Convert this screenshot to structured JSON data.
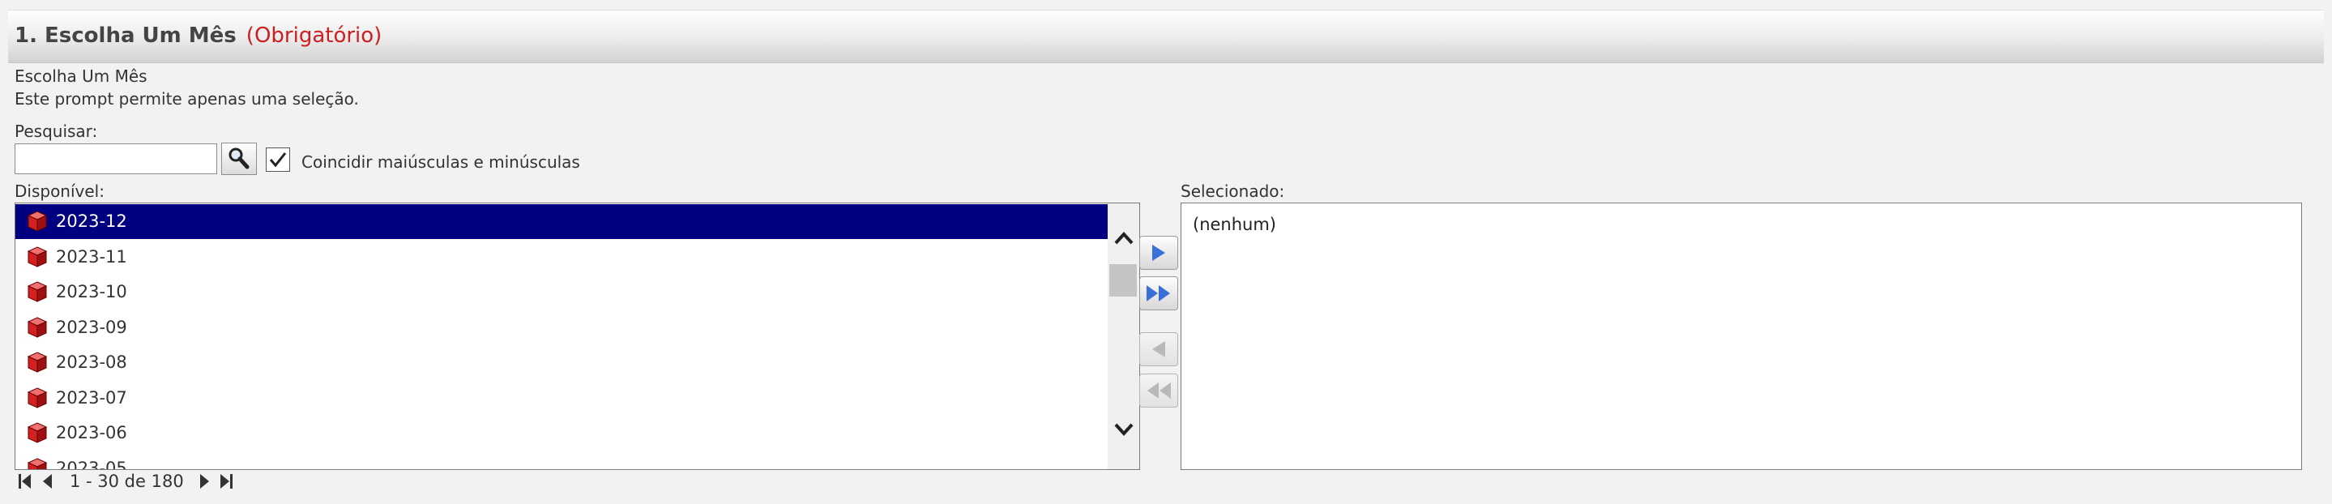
{
  "prompt": {
    "number_title": "1. Escolha Um Mês",
    "required": "(Obrigatório)",
    "description_title": "Escolha Um Mês",
    "description": "Este prompt permite apenas uma seleção."
  },
  "search": {
    "label": "Pesquisar:",
    "value": "",
    "match_case_label": "Coincidir maiúsculas e minúsculas",
    "match_case_checked": true
  },
  "available": {
    "label": "Disponível:",
    "items": [
      {
        "label": "2023-12",
        "selected": true
      },
      {
        "label": "2023-11",
        "selected": false
      },
      {
        "label": "2023-10",
        "selected": false
      },
      {
        "label": "2023-09",
        "selected": false
      },
      {
        "label": "2023-08",
        "selected": false
      },
      {
        "label": "2023-07",
        "selected": false
      },
      {
        "label": "2023-06",
        "selected": false
      },
      {
        "label": "2023-05",
        "selected": false
      }
    ]
  },
  "selected": {
    "label": "Selecionado:",
    "empty_text": "(nenhum)"
  },
  "pager": {
    "text": "1 - 30 de 180"
  },
  "colors": {
    "selection": "#000080",
    "required": "#cc1f1f",
    "cube": "#d32020",
    "arrow_active": "#3a6fd8",
    "arrow_disabled": "#b9b9b9"
  }
}
